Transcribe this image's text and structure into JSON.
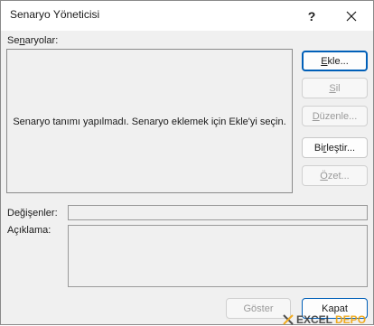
{
  "window": {
    "title": "Senaryo Yöneticisi",
    "help_label": "?"
  },
  "scenarios": {
    "label_pre": "Se",
    "label_ul": "n",
    "label_post": "aryolar:",
    "empty_message": "Senaryo tanımı yapılmadı. Senaryo eklemek için Ekle'yi seçin."
  },
  "buttons": {
    "add": {
      "pre": "",
      "ul": "E",
      "post": "kle..."
    },
    "delete": {
      "pre": "",
      "ul": "S",
      "post": "il"
    },
    "edit": {
      "pre": "",
      "ul": "D",
      "post": "üzenle..."
    },
    "merge": {
      "pre": "Bi",
      "ul": "r",
      "post": "leştir..."
    },
    "summary": {
      "pre": "",
      "ul": "Ö",
      "post": "zet..."
    },
    "show": "Göster",
    "close": "Kapat"
  },
  "fields": {
    "changing_label": "Değişenler:",
    "comment_label": "Açıklama:"
  },
  "watermark": {
    "part1": "EXCEL",
    "part2": "DEPO"
  },
  "colors": {
    "accent": "#005fb8",
    "dialog_bg": "#f0f0f0",
    "watermark_orange": "#f0a000"
  }
}
